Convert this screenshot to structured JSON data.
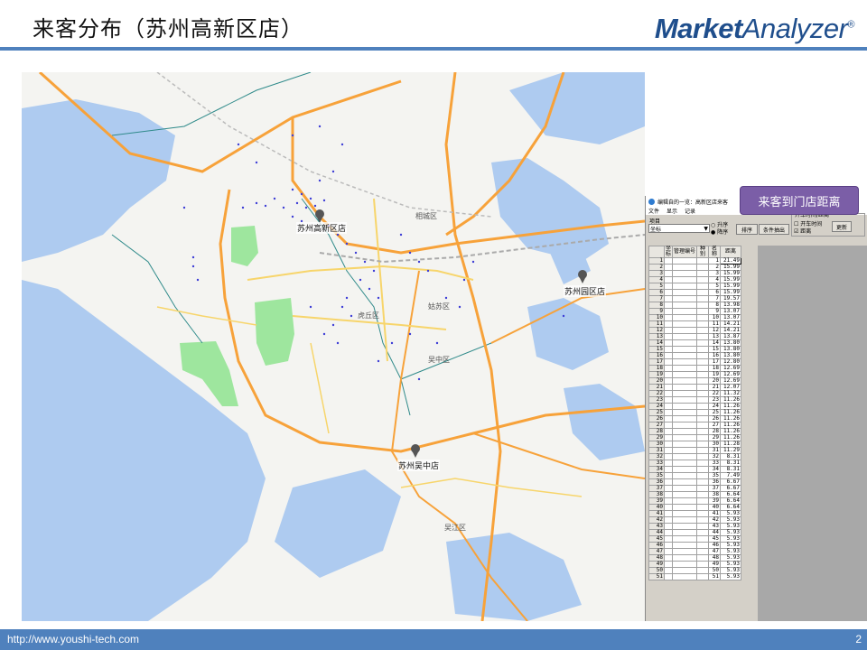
{
  "header": {
    "title": "来客分布（苏州高新区店）",
    "logo_bold": "Market",
    "logo_light": "Analyzer",
    "logo_mark": "®"
  },
  "map": {
    "stores": [
      {
        "name": "苏州高新区店"
      },
      {
        "name": "苏州园区店"
      },
      {
        "name": "苏州吴中店"
      }
    ],
    "districts": [
      "相城区",
      "虎丘区",
      "姑苏区",
      "吴中区",
      "吴江区"
    ]
  },
  "callout": "来客到门店距离",
  "app": {
    "window_title": "编辑自的一览：高新区店来客",
    "menu": [
      "文件",
      "显示",
      "记录"
    ],
    "item_label": "项目",
    "item_select": "坐标",
    "radio_asc": "升序",
    "radio_desc": "降序",
    "sort_button": "排序",
    "extract_button": "条件抽出",
    "group_label": "开车时间/距离",
    "check_time": "开车时间",
    "check_distance": "距离",
    "update_button": "更新",
    "columns": [
      "坐标",
      "管理编号",
      "种别",
      "名称",
      "距离"
    ],
    "rows": [
      [
        "1",
        "21.49"
      ],
      [
        "2",
        "15.99"
      ],
      [
        "3",
        "15.99"
      ],
      [
        "4",
        "15.99"
      ],
      [
        "5",
        "15.99"
      ],
      [
        "6",
        "15.99"
      ],
      [
        "7",
        "19.57"
      ],
      [
        "8",
        "13.98"
      ],
      [
        "9",
        "13.07"
      ],
      [
        "10",
        "13.07"
      ],
      [
        "11",
        "14.21"
      ],
      [
        "12",
        "14.21"
      ],
      [
        "13",
        "13.87"
      ],
      [
        "14",
        "13.80"
      ],
      [
        "15",
        "13.80"
      ],
      [
        "16",
        "13.80"
      ],
      [
        "17",
        "12.80"
      ],
      [
        "18",
        "12.69"
      ],
      [
        "19",
        "12.69"
      ],
      [
        "20",
        "12.69"
      ],
      [
        "21",
        "12.07"
      ],
      [
        "22",
        "11.32"
      ],
      [
        "23",
        "11.26"
      ],
      [
        "24",
        "11.26"
      ],
      [
        "25",
        "11.26"
      ],
      [
        "26",
        "11.26"
      ],
      [
        "27",
        "11.26"
      ],
      [
        "28",
        "11.26"
      ],
      [
        "29",
        "11.26"
      ],
      [
        "30",
        "11.28"
      ],
      [
        "31",
        "11.29"
      ],
      [
        "32",
        "8.31"
      ],
      [
        "33",
        "8.31"
      ],
      [
        "34",
        "8.31"
      ],
      [
        "35",
        "7.49"
      ],
      [
        "36",
        "6.67"
      ],
      [
        "37",
        "6.67"
      ],
      [
        "38",
        "6.64"
      ],
      [
        "39",
        "6.64"
      ],
      [
        "40",
        "6.64"
      ],
      [
        "41",
        "5.93"
      ],
      [
        "42",
        "5.93"
      ],
      [
        "43",
        "5.93"
      ],
      [
        "44",
        "5.93"
      ],
      [
        "45",
        "5.93"
      ],
      [
        "46",
        "5.93"
      ],
      [
        "47",
        "5.93"
      ],
      [
        "48",
        "5.93"
      ],
      [
        "49",
        "5.93"
      ],
      [
        "50",
        "5.93"
      ],
      [
        "51",
        "5.93"
      ]
    ]
  },
  "footer": {
    "url": "http://www.youshi-tech.com",
    "page": "2"
  },
  "colors": {
    "accent": "#4f81bd",
    "callout": "#7b5ea7",
    "road": "#f7a23a",
    "water": "#aecbf0"
  }
}
